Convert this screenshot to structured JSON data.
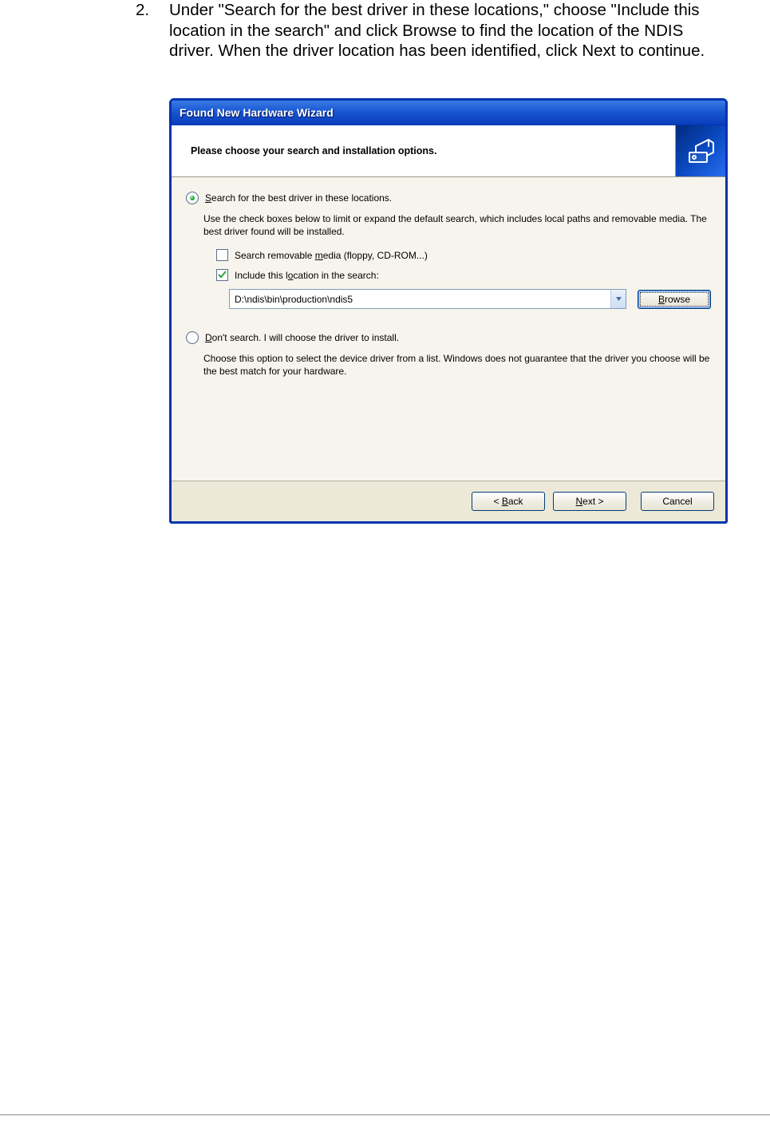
{
  "instruction": {
    "number": "2.",
    "text": "Under \"Search for the best driver in these locations,\" choose \"Include this location in the search\" and click Browse to find the location of the NDIS driver. When the driver location has been identified, click Next to continue."
  },
  "dialog": {
    "title": "Found New Hardware Wizard",
    "heading": "Please choose your search and installation options.",
    "radio_search": {
      "label_pre": "S",
      "label_rest": "earch for the best driver in these locations.",
      "selected": true
    },
    "search_desc": "Use the check boxes below to limit or expand the default search, which includes local paths and removable media. The best driver found will be installed.",
    "check_media": {
      "label_pre": "Search removable ",
      "label_mn": "m",
      "label_post": "edia (floppy, CD-ROM...)",
      "checked": false
    },
    "check_include": {
      "label_pre": "Include this l",
      "label_mn": "o",
      "label_post": "cation in the search:",
      "checked": true
    },
    "path_value": "D:\\ndis\\bin\\production\\ndis5",
    "browse_pre": "B",
    "browse_rest": "rowse",
    "radio_manual": {
      "label_mn": "D",
      "label_rest": "on't search. I will choose the driver to install.",
      "selected": false
    },
    "manual_desc": "Choose this option to select the device driver from a list.  Windows does not guarantee that the driver you choose will be the best match for your hardware.",
    "buttons": {
      "back_pre": "< ",
      "back_mn": "B",
      "back_rest": "ack",
      "next_mn": "N",
      "next_rest": "ext >",
      "cancel": "Cancel"
    }
  }
}
